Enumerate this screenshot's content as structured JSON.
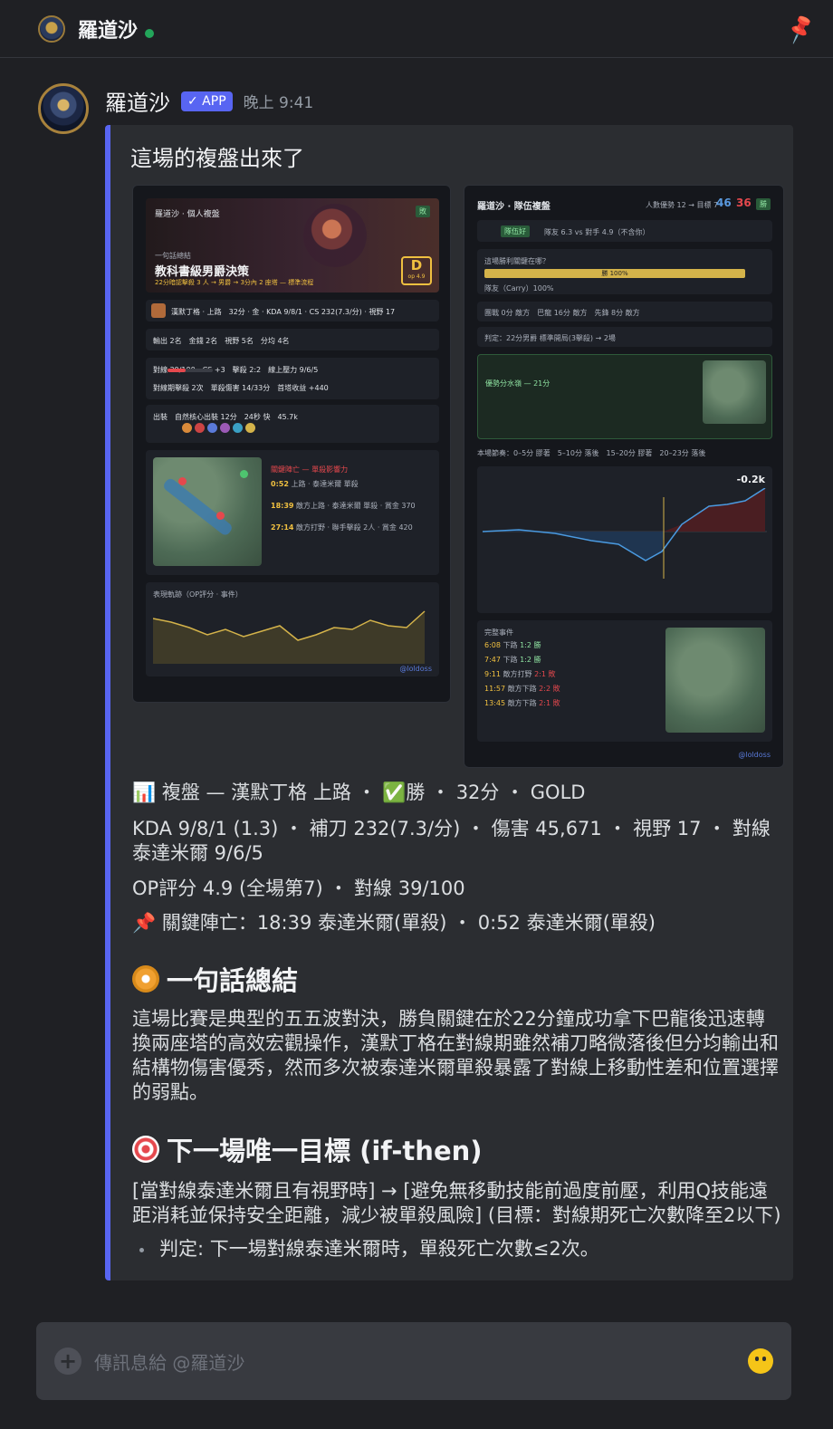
{
  "header": {
    "channel_name": "羅道沙"
  },
  "message": {
    "author": "羅道沙",
    "app_badge": "✓ APP",
    "time": "晚上 9:41",
    "embed": {
      "title": "這場的複盤出來了",
      "left_card": {
        "app": "羅道沙 · 個人複盤",
        "tag": "敗",
        "one_line_label": "一句話總結",
        "headline": "教科書級男爵決策",
        "subline": "22分暗認擊殺 3 人 → 男爵 → 3分內 2 座塔 — 標準流程",
        "grade": "D",
        "grade_sub": "op 4.9",
        "champ_row": "漢默丁格 · 上路　32分 · 金 · KDA 9/8/1 · CS 232(7.3/分) · 視野 17",
        "rank_row": "輸出 2名　金錢 2名　視野 5名　分均 4名",
        "lane_row": "對線 39/100　CS +3　擊殺 2:2　線上壓力 9/6/5",
        "laning_row": "對線期擊殺 2次　單殺傷害 14/33分　首塔收益 +440",
        "items_row": "出裝　自然核心出裝 12分　24秒 快　45.7k",
        "events_title": "關鍵陣亡 — 單殺影響力",
        "events": [
          {
            "t": "0:52",
            "d": "上路 · 泰達米爾 單殺"
          },
          {
            "t": "18:39",
            "d": "敵方上路 · 泰達米爾 單殺 · 賞金 370"
          },
          {
            "t": "27:14",
            "d": "敵方打野 · 聯手擊殺 2人 · 賞金 420"
          }
        ],
        "chart_title": "表現軌跡（OP評分 · 事件）",
        "footer": "@loldoss"
      },
      "right_card": {
        "app": "羅道沙 · 隊伍複盤",
        "score_label": "人數優勢 12 → 目標 7",
        "score_blue": "46",
        "score_red": "36",
        "tag": "勝",
        "team_tag": "隊伍好",
        "team_row": "隊友 6.3 vs 對手 4.9（不含你）",
        "q_label": "這場勝利關鍵在哪？",
        "q_bar": "勝 100%",
        "carry_row": "隊友（Carry）100%",
        "obj_row": "團戰 0分 敵方　巴龍 16分 敵方　先鋒 8分 敵方",
        "judge_row": "判定：22分男爵 標準開局(3擊殺) → 2場",
        "team_info": "優勢分水嶺 — 21分",
        "phase_row": "本場節奏：0–5分 膠著　5–10分 落後　15–20分 膠著　20–23分 落後",
        "gold_value": "-0.2k",
        "events_title": "完整事件",
        "events": [
          {
            "t": "6:08",
            "d": "下路",
            "r": "1:2 勝"
          },
          {
            "t": "7:47",
            "d": "下路",
            "r": "1:2 勝"
          },
          {
            "t": "9:11",
            "d": "敵方打野",
            "r": "2:1 敗"
          },
          {
            "t": "11:57",
            "d": "敵方下路",
            "r": "2:2 敗"
          },
          {
            "t": "13:45",
            "d": "敵方下路",
            "r": "2:1 敗"
          }
        ],
        "footer": "@loldoss"
      },
      "summary_line1": "📊 複盤 — 漢默丁格 上路 ・ ✅勝 ・ 32分 ・ GOLD",
      "summary_line2": "KDA 9/8/1 (1.3) ・ 補刀 232(7.3/分) ・ 傷害 45,671 ・ 視野 17 ・ 對線 泰達米爾 9/6/5",
      "summary_line3": "OP評分 4.9 (全場第7) ・ 對線 39/100",
      "summary_line4": "📌 關鍵陣亡：18:39 泰達米爾(單殺) ・ 0:52 泰達米爾(單殺)",
      "h_summary": "一句話總結",
      "summary_paragraph": "這場比賽是典型的五五波對決，勝負關鍵在於22分鐘成功拿下巴龍後迅速轉換兩座塔的高效宏觀操作，漢默丁格在對線期雖然補刀略微落後但分均輸出和結構物傷害優秀，然而多次被泰達米爾單殺暴露了對線上移動性差和位置選擇的弱點。",
      "h_goal": "下一場唯一目標 (if-then)",
      "goal_paragraph": "[當對線泰達米爾且有視野時] → [避免無移動技能前過度前壓，利用Q技能遠距消耗並保持安全距離，減少被單殺風險] (目標：對線期死亡次數降至2以下)",
      "goal_bullet": "判定: 下一場對線泰達米爾時，單殺死亡次數≤2次。"
    }
  },
  "composer": {
    "placeholder": "傳訊息給 @羅道沙"
  },
  "colors": {
    "accent": "#5865f2",
    "online": "#23a55a",
    "gold": "#f0c040",
    "red": "#e5484d"
  }
}
